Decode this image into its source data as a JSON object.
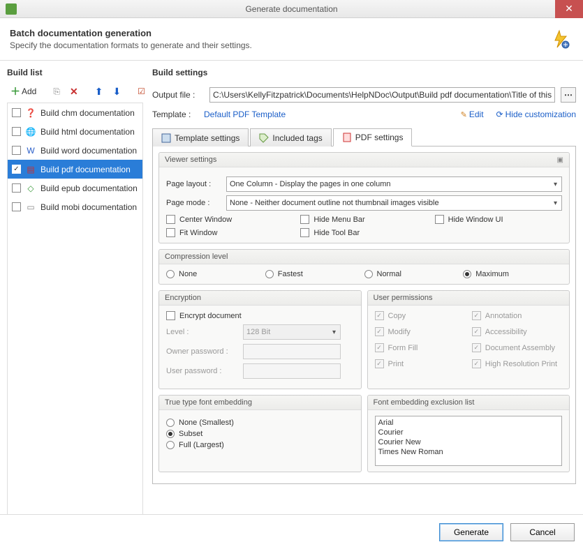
{
  "titlebar": {
    "title": "Generate documentation"
  },
  "header": {
    "title": "Batch documentation generation",
    "subtitle": "Specify the documentation formats to generate and their settings."
  },
  "buildList": {
    "title": "Build list",
    "addLabel": "Add",
    "items": [
      {
        "label": "Build chm documentation",
        "checked": false,
        "iconCls": "ic-chm",
        "glyph": "❓"
      },
      {
        "label": "Build html documentation",
        "checked": false,
        "iconCls": "ic-html",
        "glyph": "🌐"
      },
      {
        "label": "Build word documentation",
        "checked": false,
        "iconCls": "ic-word",
        "glyph": "W"
      },
      {
        "label": "Build pdf documentation",
        "checked": true,
        "selected": true,
        "iconCls": "ic-pdf",
        "glyph": "▤"
      },
      {
        "label": "Build epub documentation",
        "checked": false,
        "iconCls": "ic-epub",
        "glyph": "◇"
      },
      {
        "label": "Build mobi documentation",
        "checked": false,
        "iconCls": "ic-mobi",
        "glyph": "▭"
      }
    ]
  },
  "settings": {
    "title": "Build settings",
    "outputLabel": "Output file :",
    "outputValue": "C:\\Users\\KellyFitzpatrick\\Documents\\HelpNDoc\\Output\\Build pdf documentation\\Title of this help project.pdf",
    "templateLabel": "Template :",
    "templateName": "Default PDF Template",
    "editLabel": "Edit",
    "hideLabel": "Hide customization",
    "tabs": {
      "template": "Template settings",
      "tags": "Included tags",
      "pdf": "PDF settings"
    },
    "viewer": {
      "title": "Viewer settings",
      "pageLayoutLabel": "Page layout :",
      "pageLayoutValue": "One Column - Display the pages in one column",
      "pageModeLabel": "Page mode :",
      "pageModeValue": "None - Neither document outline not thumbnail images visible",
      "centerWindow": "Center Window",
      "hideMenuBar": "Hide Menu Bar",
      "hideWindowUI": "Hide Window UI",
      "fitWindow": "Fit Window",
      "hideToolBar": "Hide Tool Bar"
    },
    "compression": {
      "title": "Compression level",
      "none": "None",
      "fastest": "Fastest",
      "normal": "Normal",
      "maximum": "Maximum",
      "selected": "maximum"
    },
    "encryption": {
      "title": "Encryption",
      "encryptDoc": "Encrypt document",
      "levelLabel": "Level :",
      "levelValue": "128 Bit",
      "ownerLabel": "Owner password :",
      "userLabel": "User password :"
    },
    "permissions": {
      "title": "User permissions",
      "copy": "Copy",
      "annotation": "Annotation",
      "modify": "Modify",
      "accessibility": "Accessibility",
      "formFill": "Form Fill",
      "docAssembly": "Document Assembly",
      "print": "Print",
      "highRes": "High Resolution Print"
    },
    "fontEmbed": {
      "title": "True type font embedding",
      "none": "None (Smallest)",
      "subset": "Subset",
      "full": "Full (Largest)",
      "selected": "subset"
    },
    "fontExclusion": {
      "title": "Font embedding exclusion list",
      "fonts": [
        "Arial",
        "Courier",
        "Courier New",
        "Times New Roman"
      ]
    }
  },
  "footer": {
    "generate": "Generate",
    "cancel": "Cancel"
  }
}
